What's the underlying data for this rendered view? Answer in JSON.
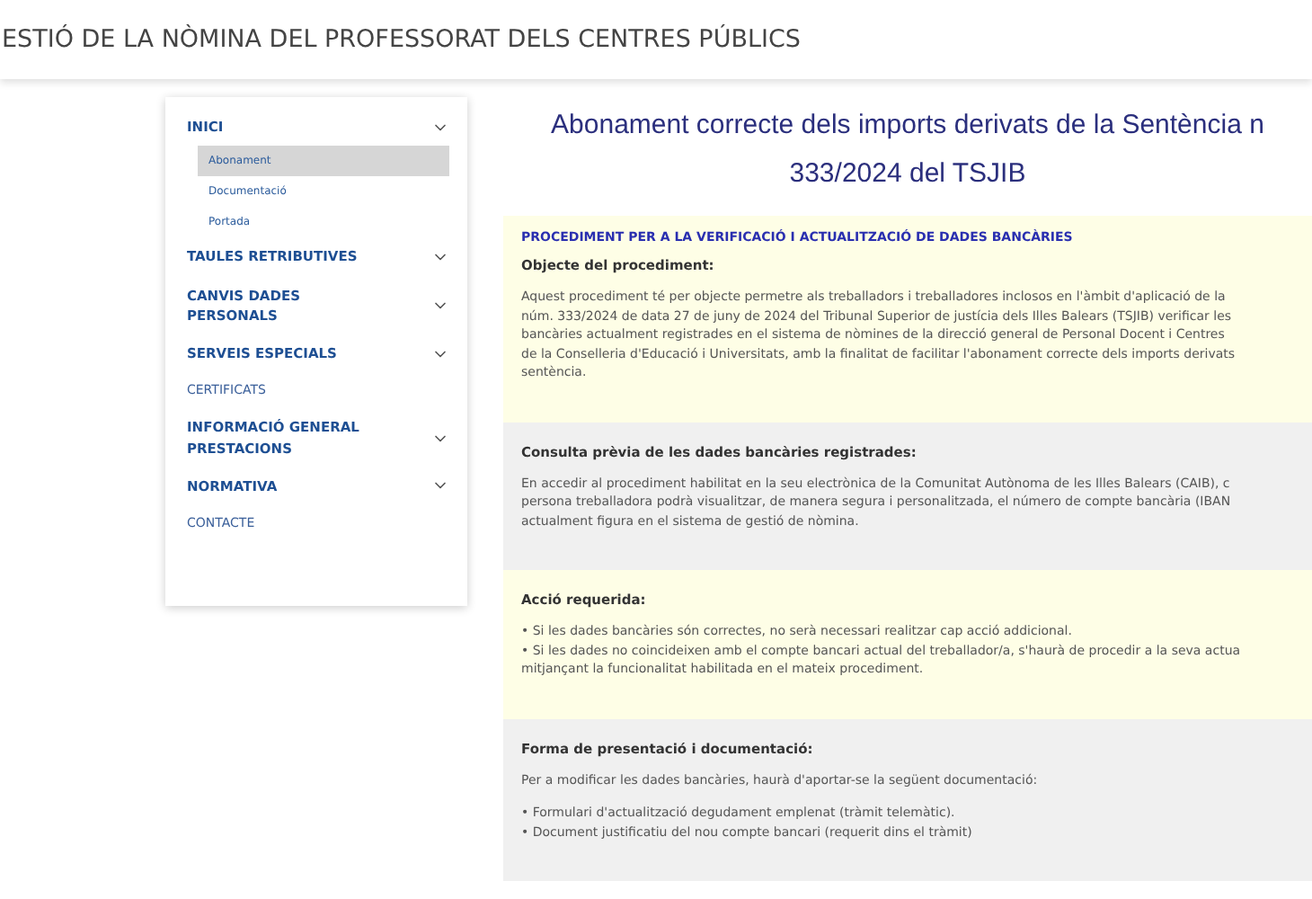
{
  "header": {
    "title": "ESTIÓ DE LA NÒMINA DEL PROFESSORAT DELS CENTRES PÚBLICS"
  },
  "sidebar": {
    "items": [
      {
        "kind": "group",
        "label": "INICI",
        "children": [
          {
            "label": "Abonament",
            "selected": true
          },
          {
            "label": "Documentació",
            "selected": false
          },
          {
            "label": "Portada",
            "selected": false
          }
        ]
      },
      {
        "kind": "group",
        "label": "TAULES RETRIBUTIVES"
      },
      {
        "kind": "group",
        "label": "CANVIS DADES PERSONALS"
      },
      {
        "kind": "group",
        "label": "SERVEIS ESPECIALS"
      },
      {
        "kind": "link",
        "label": "CERTIFICATS"
      },
      {
        "kind": "group",
        "label": "INFORMACIÓ GENERAL PRESTACIONS"
      },
      {
        "kind": "group",
        "label": "NORMATIVA"
      },
      {
        "kind": "link",
        "label": "CONTACTE"
      }
    ]
  },
  "main": {
    "title_lines": [
      "Abonament correcte dels imports derivats de la Sentència n",
      "333/2024 del TSJIB"
    ],
    "sections": [
      {
        "kind": "highlight",
        "heading": "PROCEDIMENT PER A LA VERIFICACIÓ I ACTUALITZACIÓ DE DADES BANCÀRIES",
        "subheading": "Objecte del procediment:",
        "paragraphs": [
          [
            "Aquest procediment té per objecte permetre als treballadors i treballadores inclosos en l'àmbit d'aplicació de la",
            "núm. 333/2024 de data 27 de juny de 2024 del Tribunal Superior de justícia dels Illes Balears (TSJIB) verificar les",
            "bancàries actualment registrades en el sistema de nòmines de la direcció general de Personal Docent i Centres",
            "de la Conselleria d'Educació i Universitats, amb la finalitat de facilitar l'abonament correcte dels imports derivats",
            "sentència."
          ]
        ]
      },
      {
        "kind": "plain",
        "subheading": "Consulta prèvia de les dades bancàries registrades:",
        "paragraphs": [
          [
            "En accedir al procediment habilitat en la seu electrònica de la Comunitat Autònoma de les Illes Balears (CAIB), c",
            "persona treballadora podrà visualitzar, de manera segura i personalitzada, el número de compte bancària (IBAN",
            "actualment figura en el sistema de gestió de nòmina."
          ]
        ]
      },
      {
        "kind": "highlight",
        "subheading": "Acció requerida:",
        "paragraphs": [
          [
            "• Si les dades bancàries són correctes, no serà necessari realitzar cap acció addicional.",
            "• Si les dades no coincideixen amb el compte bancari actual del treballador/a, s'haurà de procedir a la seva actua",
            "mitjançant la funcionalitat habilitada en el mateix procediment."
          ]
        ]
      },
      {
        "kind": "plain",
        "subheading": "Forma de presentació i documentació:",
        "paragraphs": [
          [
            "Per a modificar les dades bancàries, haurà d'aportar-se la següent documentació:"
          ],
          [
            "• Formulari d'actualització degudament emplenat (tràmit telemàtic).",
            "• Document justificatiu del nou compte bancari (requerit dins el tràmit)"
          ]
        ]
      }
    ]
  }
}
